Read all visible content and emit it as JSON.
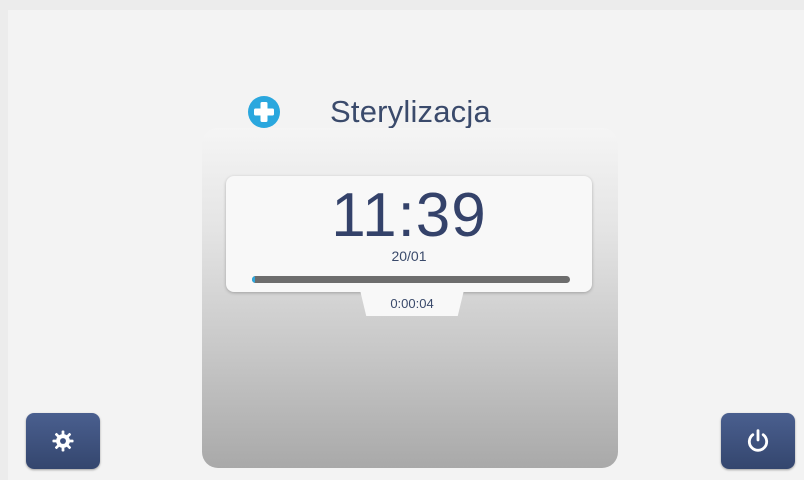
{
  "header": {
    "icon": "plus-icon",
    "title": "Sterylizacja"
  },
  "clock": {
    "time": "11:39",
    "date": "20/01"
  },
  "progress": {
    "fraction": 0.01,
    "elapsed": "0:00:04"
  },
  "buttons": {
    "settings_icon": "gear-icon",
    "power_icon": "power-icon"
  },
  "colors": {
    "accent": "#2aa7de",
    "button": "#3b4f7e",
    "text": "#34426a",
    "progress_track": "#6d6d6d"
  }
}
